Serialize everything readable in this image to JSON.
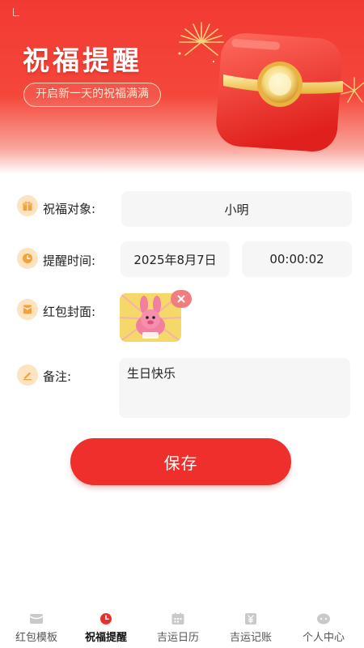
{
  "banner": {
    "title": "祝福提醒",
    "subtitle": "开启新一天的祝福满满"
  },
  "form": {
    "recipient": {
      "label": "祝福对象:",
      "value": "小明",
      "icon": "gift-icon"
    },
    "reminder_time": {
      "label": "提醒时间:",
      "date": "2025年8月7日",
      "time": "00:00:02",
      "icon": "clock-icon"
    },
    "cover": {
      "label": "红包封面:",
      "icon": "red-envelope-icon"
    },
    "note": {
      "label": "备注:",
      "value": "生日快乐",
      "icon": "pencil-icon"
    }
  },
  "save_button": {
    "label": "保存"
  },
  "tabbar": {
    "tabs": [
      {
        "label": "红包模板",
        "icon": "envelope-icon",
        "active": false
      },
      {
        "label": "祝福提醒",
        "icon": "clock-icon",
        "active": true
      },
      {
        "label": "吉运日历",
        "icon": "calendar-icon",
        "active": false
      },
      {
        "label": "吉运记账",
        "icon": "ledger-icon",
        "active": false
      },
      {
        "label": "个人中心",
        "icon": "user-icon",
        "active": false
      }
    ]
  },
  "colors": {
    "primary": "#ef2f2b",
    "icon_bg": "#fde3c0",
    "icon_fg": "#f2a23a",
    "field_bg": "#f6f6f6"
  }
}
